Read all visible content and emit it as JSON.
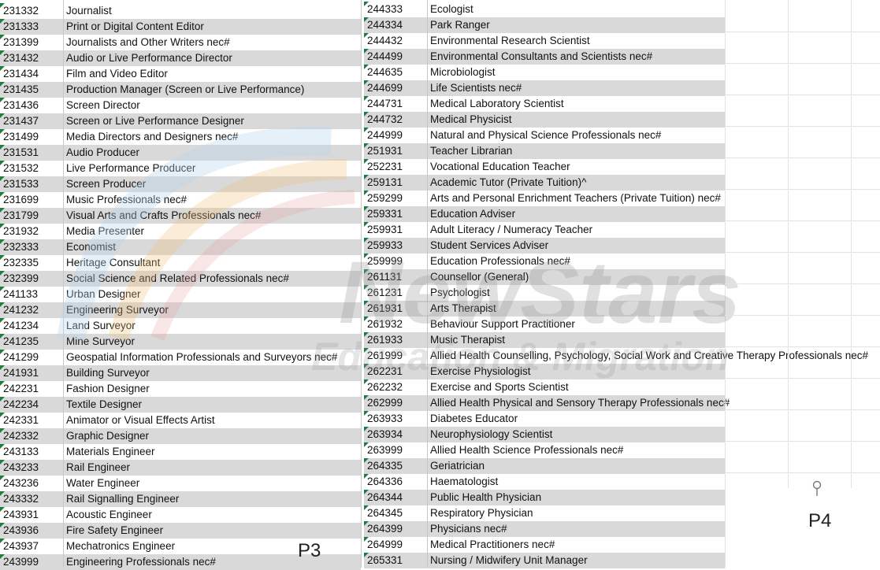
{
  "left_rows": [
    {
      "code": "231332",
      "title": "Journalist"
    },
    {
      "code": "231333",
      "title": "Print or Digital Content Editor"
    },
    {
      "code": "231399",
      "title": "Journalists and Other Writers nec#"
    },
    {
      "code": "231432",
      "title": "Audio or Live Performance Director"
    },
    {
      "code": "231434",
      "title": "Film and Video Editor"
    },
    {
      "code": "231435",
      "title": "Production Manager (Screen or Live Performance)"
    },
    {
      "code": "231436",
      "title": "Screen Director"
    },
    {
      "code": "231437",
      "title": "Screen or Live Performance Designer"
    },
    {
      "code": "231499",
      "title": "Media Directors and Designers nec#"
    },
    {
      "code": "231531",
      "title": "Audio Producer"
    },
    {
      "code": "231532",
      "title": "Live Performance Producer"
    },
    {
      "code": "231533",
      "title": "Screen Producer"
    },
    {
      "code": "231699",
      "title": "Music Professionals nec#"
    },
    {
      "code": "231799",
      "title": "Visual Arts and Crafts Professionals nec#"
    },
    {
      "code": "231932",
      "title": "Media Presenter"
    },
    {
      "code": "232333",
      "title": "Economist"
    },
    {
      "code": "232335",
      "title": "Heritage Consultant"
    },
    {
      "code": "232399",
      "title": "Social Science and Related Professionals nec#"
    },
    {
      "code": "241133",
      "title": "Urban Designer"
    },
    {
      "code": "241232",
      "title": "Engineering Surveyor"
    },
    {
      "code": "241234",
      "title": "Land Surveyor"
    },
    {
      "code": "241235",
      "title": "Mine Surveyor"
    },
    {
      "code": "241299",
      "title": "Geospatial Information Professionals and Surveyors nec#"
    },
    {
      "code": "241931",
      "title": "Building Surveyor"
    },
    {
      "code": "242231",
      "title": "Fashion Designer"
    },
    {
      "code": "242234",
      "title": "Textile Designer"
    },
    {
      "code": "242331",
      "title": "Animator or Visual Effects Artist"
    },
    {
      "code": "242332",
      "title": "Graphic Designer"
    },
    {
      "code": "243133",
      "title": "Materials Engineer"
    },
    {
      "code": "243233",
      "title": "Rail Engineer"
    },
    {
      "code": "243236",
      "title": "Water Engineer"
    },
    {
      "code": "243332",
      "title": "Rail Signalling Engineer"
    },
    {
      "code": "243931",
      "title": "Acoustic Engineer"
    },
    {
      "code": "243936",
      "title": "Fire Safety Engineer"
    },
    {
      "code": "243937",
      "title": "Mechatronics Engineer"
    },
    {
      "code": "243999",
      "title": "Engineering Professionals nec#"
    }
  ],
  "right_rows": [
    {
      "code": "244333",
      "title": "Ecologist"
    },
    {
      "code": "244334",
      "title": "Park Ranger"
    },
    {
      "code": "244432",
      "title": "Environmental Research Scientist"
    },
    {
      "code": "244499",
      "title": "Environmental Consultants and Scientists nec#"
    },
    {
      "code": "244635",
      "title": "Microbiologist"
    },
    {
      "code": "244699",
      "title": "Life Scientists nec#"
    },
    {
      "code": "244731",
      "title": "Medical Laboratory Scientist"
    },
    {
      "code": "244732",
      "title": "Medical Physicist"
    },
    {
      "code": "244999",
      "title": "Natural and Physical Science Professionals nec#"
    },
    {
      "code": "251931",
      "title": "Teacher Librarian"
    },
    {
      "code": "252231",
      "title": "Vocational Education Teacher"
    },
    {
      "code": "259131",
      "title": "Academic Tutor (Private Tuition)^"
    },
    {
      "code": "259299",
      "title": "Arts and Personal Enrichment Teachers (Private Tuition) nec#"
    },
    {
      "code": "259331",
      "title": "Education Adviser"
    },
    {
      "code": "259931",
      "title": "Adult Literacy / Numeracy Teacher"
    },
    {
      "code": "259933",
      "title": "Student Services Adviser"
    },
    {
      "code": "259999",
      "title": "Education Professionals nec#"
    },
    {
      "code": "261131",
      "title": "Counsellor (General)"
    },
    {
      "code": "261231",
      "title": "Psychologist"
    },
    {
      "code": "261931",
      "title": "Arts Therapist"
    },
    {
      "code": "261932",
      "title": "Behaviour Support Practitioner"
    },
    {
      "code": "261933",
      "title": "Music Therapist"
    },
    {
      "code": "261999",
      "title": "Allied Health Counselling, Psychology, Social Work and Creative Therapy Professionals nec#"
    },
    {
      "code": "262231",
      "title": "Exercise Physiologist"
    },
    {
      "code": "262232",
      "title": "Exercise and Sports Scientist"
    },
    {
      "code": "262999",
      "title": "Allied Health Physical and Sensory Therapy Professionals nec#"
    },
    {
      "code": "263933",
      "title": "Diabetes Educator"
    },
    {
      "code": "263934",
      "title": "Neurophysiology Scientist"
    },
    {
      "code": "263999",
      "title": "Allied Health Science Professionals nec#"
    },
    {
      "code": "264335",
      "title": "Geriatrician"
    },
    {
      "code": "264336",
      "title": "Haematologist"
    },
    {
      "code": "264344",
      "title": "Public Health Physician"
    },
    {
      "code": "264345",
      "title": "Respiratory Physician"
    },
    {
      "code": "264399",
      "title": "Physicians nec#"
    },
    {
      "code": "264999",
      "title": "Medical Practitioners nec#"
    },
    {
      "code": "265331",
      "title": "Nursing / Midwifery Unit Manager"
    }
  ],
  "page_labels": {
    "left": "P3",
    "right": "P4"
  },
  "watermark": {
    "line1": "NewStars",
    "line2": "Education & Migration"
  },
  "colors": {
    "shade": "#d9d9d9",
    "marker": "#1e7f3c"
  }
}
